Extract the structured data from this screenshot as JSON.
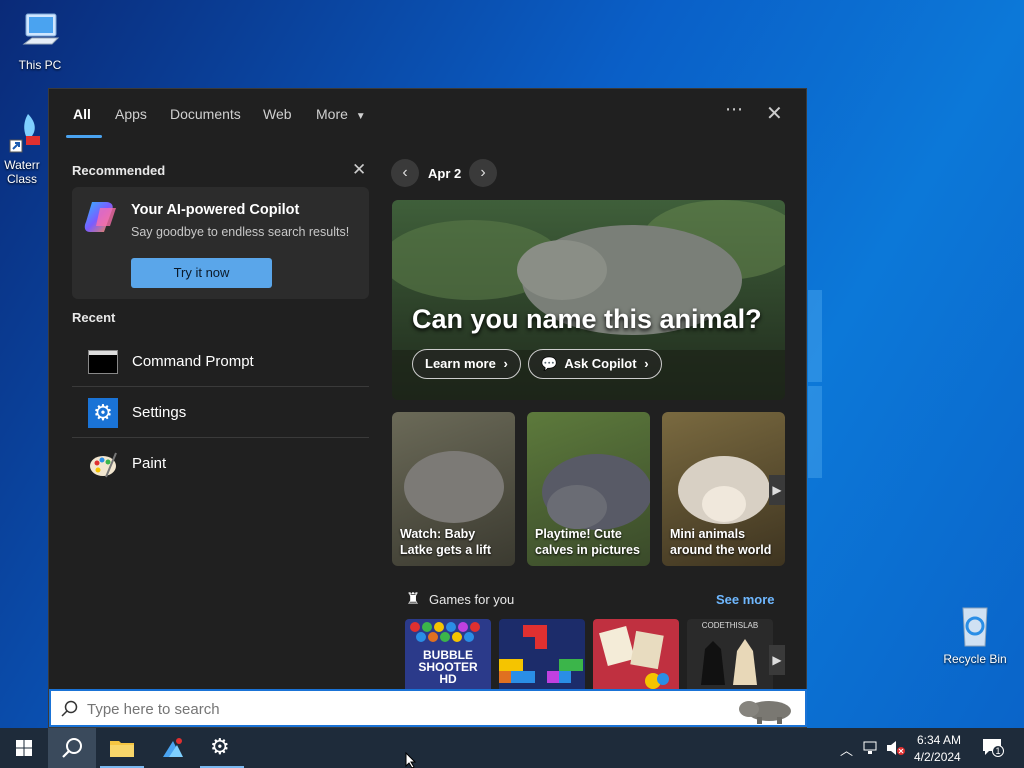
{
  "desktop": {
    "icons": [
      {
        "label": "This PC"
      },
      {
        "label": "Waterr Class"
      },
      {
        "label": "Recycle Bin"
      }
    ]
  },
  "search_panel": {
    "tabs": [
      "All",
      "Apps",
      "Documents",
      "Web",
      "More"
    ],
    "recommended": {
      "title": "Recommended",
      "card_title": "Your AI-powered Copilot",
      "card_subtitle": "Say goodbye to endless search results!",
      "button": "Try it now"
    },
    "recent": {
      "title": "Recent",
      "items": [
        {
          "label": "Command Prompt",
          "icon": "cmd-icon"
        },
        {
          "label": "Settings",
          "icon": "gear-icon"
        },
        {
          "label": "Paint",
          "icon": "palette-icon"
        }
      ]
    },
    "highlights": {
      "date": "Apr 2",
      "hero_title": "Can you name this animal?",
      "learn_more": "Learn more",
      "ask_copilot": "Ask Copilot",
      "tiles": [
        {
          "caption": "Watch: Baby Latke gets a lift"
        },
        {
          "caption": "Playtime! Cute calves in pictures"
        },
        {
          "caption": "Mini animals around the world"
        }
      ]
    },
    "games": {
      "title": "Games for you",
      "see_more": "See more",
      "tiles": [
        {
          "label": "BUBBLE SHOOTER HD"
        },
        {
          "label": ""
        },
        {
          "label": ""
        },
        {
          "label": "CODETHISLAB"
        }
      ]
    }
  },
  "search_input": {
    "placeholder": "Type here to search"
  },
  "taskbar": {
    "time": "6:34 AM",
    "date": "4/2/2024",
    "notification_count": "1"
  },
  "colors": {
    "accent": "#4aa3f0",
    "panel_bg": "#202020",
    "taskbar_bg": "#1e2b3a",
    "button_blue": "#5aa6ea"
  }
}
